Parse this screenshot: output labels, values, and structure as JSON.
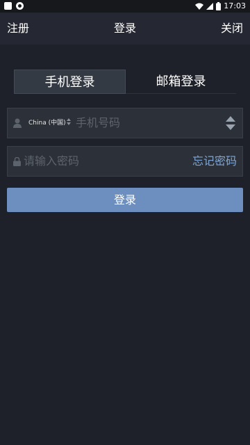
{
  "status_bar": {
    "time": "17:03",
    "icons": [
      "notification-square-icon",
      "app-circle-icon",
      "wifi-icon",
      "signal-icon",
      "battery-icon"
    ]
  },
  "nav": {
    "left": "注册",
    "title": "登录",
    "right": "关闭"
  },
  "tabs": [
    {
      "label": "手机登录",
      "active": true
    },
    {
      "label": "邮箱登录",
      "active": false
    }
  ],
  "phone_field": {
    "country": "China (中国)",
    "placeholder": "手机号码"
  },
  "password_field": {
    "placeholder": "请输入密码",
    "forgot_label": "忘记密码"
  },
  "login_button": {
    "label": "登录"
  },
  "colors": {
    "background": "#1e2129",
    "nav_background": "#252832",
    "field_background": "#2c3038",
    "accent": "#6c8fbf",
    "link": "#7fa6d4"
  }
}
